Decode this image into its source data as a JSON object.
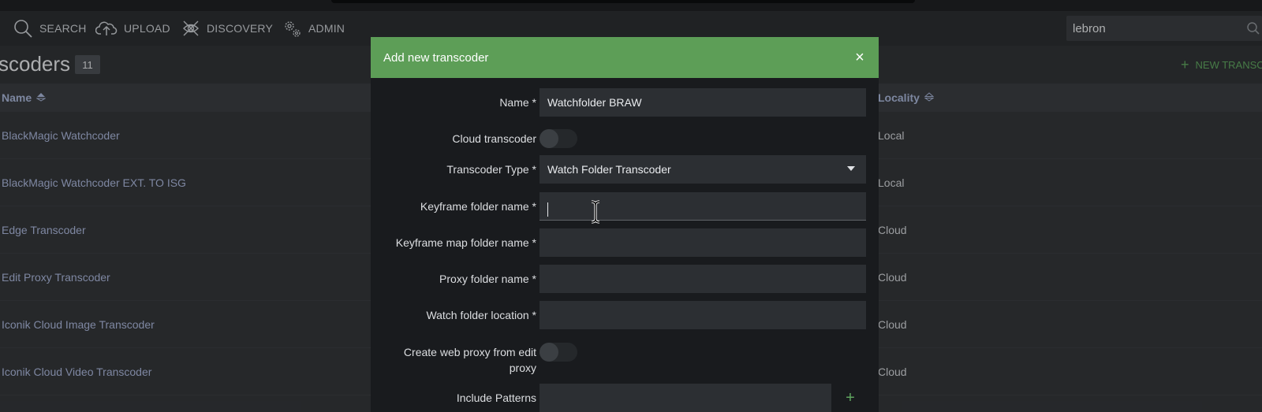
{
  "nav": {
    "items": [
      {
        "label": "SEARCH",
        "icon": "search-icon"
      },
      {
        "label": "UPLOAD",
        "icon": "cloud-upload-icon"
      },
      {
        "label": "DISCOVERY",
        "icon": "discovery-icon"
      },
      {
        "label": "ADMIN",
        "icon": "gears-icon"
      }
    ],
    "search_value": "lebron"
  },
  "page": {
    "title": "scoders",
    "count": "11",
    "new_button_label": "NEW TRANSC"
  },
  "table": {
    "columns": [
      "Name",
      "Locality"
    ],
    "rows": [
      {
        "name": "BlackMagic Watchcoder",
        "locality": "Local"
      },
      {
        "name": "BlackMagic Watchcoder EXT. TO ISG",
        "locality": "Local"
      },
      {
        "name": "Edge Transcoder",
        "locality": "Cloud"
      },
      {
        "name": "Edit Proxy Transcoder",
        "locality": "Cloud"
      },
      {
        "name": "Iconik Cloud Image Transcoder",
        "locality": "Cloud"
      },
      {
        "name": "Iconik Cloud Video Transcoder",
        "locality": "Cloud"
      }
    ]
  },
  "modal": {
    "title": "Add new transcoder",
    "close_symbol": "×",
    "fields": {
      "name_label": "Name *",
      "name_value": "Watchfolder BRAW",
      "cloud_label": "Cloud transcoder",
      "type_label": "Transcoder Type *",
      "type_value": "Watch Folder Transcoder",
      "keyframe_label": "Keyframe folder name *",
      "keyframe_value": "",
      "keyframe_map_label": "Keyframe map folder name *",
      "keyframe_map_value": "",
      "proxy_label": "Proxy folder name *",
      "proxy_value": "",
      "watch_label": "Watch folder location *",
      "watch_value": "",
      "web_proxy_label_line1": "Create web proxy from edit",
      "web_proxy_label_line2": "proxy",
      "include_label": "Include Patterns",
      "include_value": ""
    },
    "plus_symbol": "+"
  },
  "colors": {
    "accent_green": "#5d9e57",
    "link_blue": "#a9b5d8",
    "background": "#333639"
  }
}
